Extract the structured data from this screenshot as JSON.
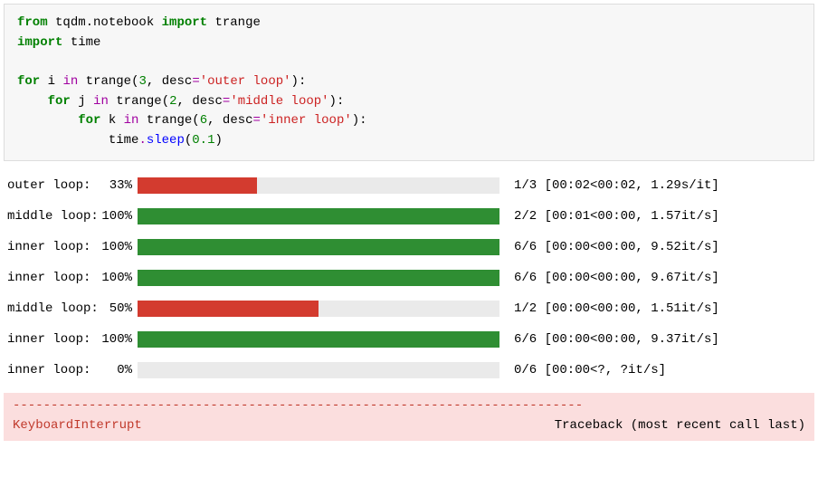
{
  "code": {
    "line1": {
      "kw1": "from",
      "mod": "tqdm.notebook",
      "kw2": "import",
      "name": "trange"
    },
    "line2": {
      "kw": "import",
      "mod": "time"
    },
    "line3": {
      "kw": "for",
      "var": "i",
      "kw2": "in",
      "fn": "trange",
      "num": "3",
      "argk": "desc",
      "str": "'outer loop'"
    },
    "line4": {
      "kw": "for",
      "var": "j",
      "kw2": "in",
      "fn": "trange",
      "num": "2",
      "argk": "desc",
      "str": "'middle loop'"
    },
    "line5": {
      "kw": "for",
      "var": "k",
      "kw2": "in",
      "fn": "trange",
      "num": "6",
      "argk": "desc",
      "str": "'inner loop'"
    },
    "line6": {
      "obj": "time",
      "meth": "sleep",
      "num": "0.1"
    }
  },
  "bars": [
    {
      "label": "outer loop:",
      "pct": "33%",
      "width": 33,
      "color": "red",
      "meta": "1/3 [00:02<00:02,  1.29s/it]"
    },
    {
      "label": "middle loop:",
      "pct": "100%",
      "width": 100,
      "color": "green",
      "meta": "2/2 [00:01<00:00,  1.57it/s]"
    },
    {
      "label": "inner loop:",
      "pct": "100%",
      "width": 100,
      "color": "green",
      "meta": "6/6 [00:00<00:00,  9.52it/s]"
    },
    {
      "label": "inner loop:",
      "pct": "100%",
      "width": 100,
      "color": "green",
      "meta": "6/6 [00:00<00:00,  9.67it/s]"
    },
    {
      "label": "middle loop:",
      "pct": "50%",
      "width": 50,
      "color": "red",
      "meta": "1/2 [00:00<00:00,  1.51it/s]"
    },
    {
      "label": "inner loop:",
      "pct": "100%",
      "width": 100,
      "color": "green",
      "meta": "6/6 [00:00<00:00,  9.37it/s]"
    },
    {
      "label": "inner loop:",
      "pct": "0%",
      "width": 0,
      "color": "green",
      "meta": "0/6 [00:00<?, ?it/s]"
    }
  ],
  "traceback": {
    "dashes": "---------------------------------------------------------------------------",
    "error": "KeyboardInterrupt",
    "trace_label": "Traceback (most recent call last)"
  }
}
